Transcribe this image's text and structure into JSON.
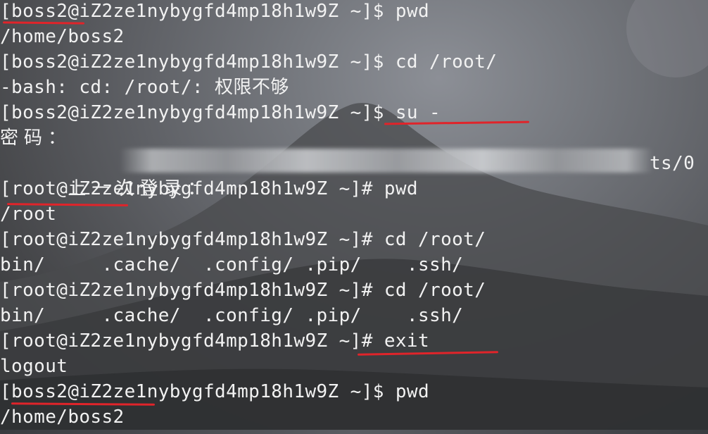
{
  "terminal": {
    "lines": [
      "[boss2@iZ2ze1nybygfd4mp18h1w9Z ~]$ pwd",
      "/home/boss2",
      "[boss2@iZ2ze1nybygfd4mp18h1w9Z ~]$ cd /root/",
      "-bash: cd: /root/: 权限不够",
      "[boss2@iZ2ze1nybygfd4mp18h1w9Z ~]$ su -",
      "密码：",
      "上一次登录：",
      "[root@iZ2ze1nybygfd4mp18h1w9Z ~]# pwd",
      "/root",
      "[root@iZ2ze1nybygfd4mp18h1w9Z ~]# cd /root/",
      "bin/     .cache/  .config/ .pip/    .ssh/",
      "[root@iZ2ze1nybygfd4mp18h1w9Z ~]# cd /root/",
      "bin/     .cache/  .config/ .pip/    .ssh/",
      "[root@iZ2ze1nybygfd4mp18h1w9Z ~]# exit",
      "logout",
      "[boss2@iZ2ze1nybygfd4mp18h1w9Z ~]$ pwd",
      "/home/boss2"
    ],
    "partial_tail": "ts/0"
  },
  "colors": {
    "text": "#f2f2f2",
    "annotation": "#e0242a"
  }
}
